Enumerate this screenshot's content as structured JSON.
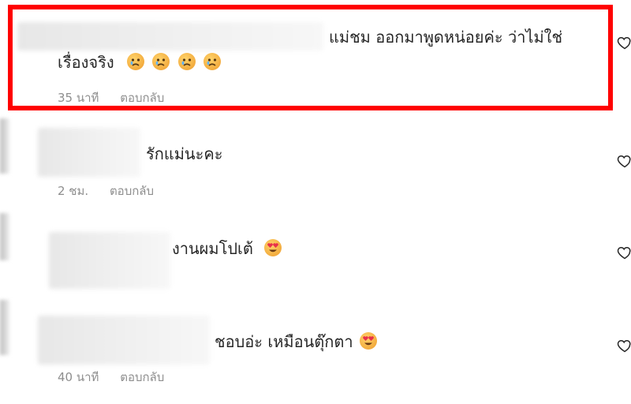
{
  "comments": [
    {
      "line1": "แม่ชม ออกมาพูดหน่อยค่ะ ว่าไม่ใช่",
      "line2": "เรื่องจริง",
      "emojis": [
        "crying-face",
        "crying-face",
        "crying-face",
        "crying-face"
      ],
      "time": "35 นาที",
      "reply": "ตอบกลับ"
    },
    {
      "text": "รักแม่นะคะ",
      "time": "2 ชม.",
      "reply": "ตอบกลับ"
    },
    {
      "text": "งานผมโปเต้",
      "emojis": [
        "heart-eyes-face"
      ]
    },
    {
      "text": "ชอบอ่ะ เหมือนตุ๊กตา",
      "emojis": [
        "heart-eyes-face"
      ],
      "time": "40 นาที",
      "reply": "ตอบกลับ"
    }
  ],
  "colors": {
    "highlight": "#ff0000",
    "meta_text": "#8e8e8e",
    "comment_text": "#262626"
  }
}
